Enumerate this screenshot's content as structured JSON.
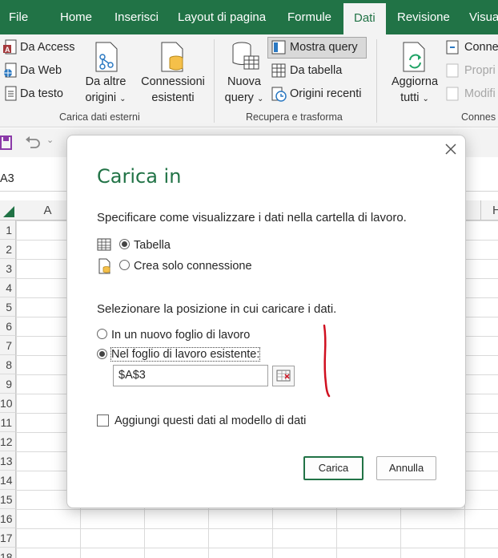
{
  "ribbon_tabs": [
    "File",
    "Home",
    "Inserisci",
    "Layout di pagina",
    "Formule",
    "Dati",
    "Revisione",
    "Visua"
  ],
  "active_tab": "Dati",
  "ribbon": {
    "da_access": "Da Access",
    "da_web": "Da Web",
    "da_testo": "Da testo",
    "da_altre_origini_1": "Da altre",
    "da_altre_origini_2": "origini",
    "connessioni_1": "Connessioni",
    "connessioni_2": "esistenti",
    "group_carica": "Carica dati esterni",
    "nuova_query_1": "Nuova",
    "nuova_query_2": "query",
    "mostra_query": "Mostra query",
    "da_tabella": "Da tabella",
    "origini_recenti": "Origini recenti",
    "group_recupera": "Recupera e trasforma",
    "aggiorna_1": "Aggiorna",
    "aggiorna_2": "tutti",
    "conne": "Conne",
    "propri": "Propri",
    "modifi": "Modifi",
    "group_conness": "Connes"
  },
  "name_box": "A3",
  "columns": [
    "A",
    "H"
  ],
  "rows": [
    "1",
    "2",
    "3",
    "4",
    "5",
    "6",
    "7",
    "8",
    "9",
    "10",
    "11",
    "12",
    "13",
    "14",
    "15",
    "16",
    "17",
    "18"
  ],
  "dialog": {
    "title": "Carica in",
    "prompt_view": "Specificare come visualizzare i dati nella cartella di lavoro.",
    "option_table": "Tabella",
    "option_connection": "Crea solo connessione",
    "prompt_position": "Selezionare la posizione in cui caricare i dati.",
    "option_new_sheet": "In un nuovo foglio di lavoro",
    "option_existing_sheet": "Nel foglio di lavoro esistente:",
    "reference_value": "$A$3",
    "add_to_model": "Aggiungi questi dati al modello di dati",
    "load_button": "Carica",
    "cancel_button": "Annulla",
    "selected_view": "Tabella",
    "selected_position": "Nel foglio di lavoro esistente:",
    "add_to_model_checked": false
  },
  "colors": {
    "excel_green": "#217346",
    "annotation_red": "#d01020"
  }
}
